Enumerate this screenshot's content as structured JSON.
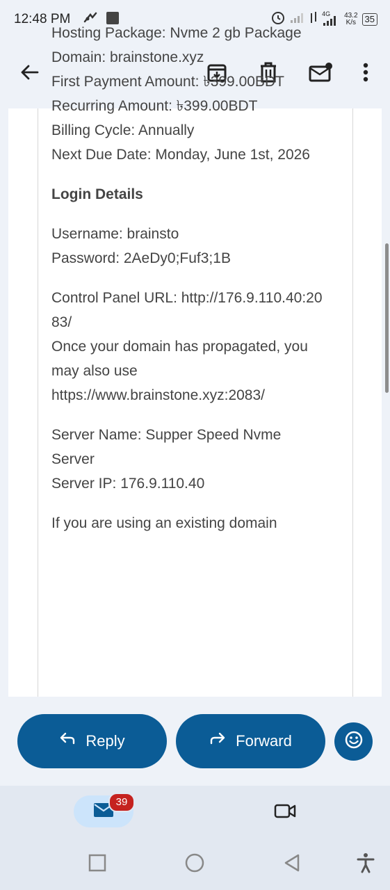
{
  "status_bar": {
    "time": "12:48 PM",
    "network_type": "4G",
    "speed_value": "43.2",
    "speed_unit": "K/s",
    "battery": "35"
  },
  "appbar": {
    "icons": [
      "back-arrow-icon",
      "archive-icon",
      "delete-icon",
      "mark-unread-icon",
      "more-vert-icon"
    ]
  },
  "email": {
    "paragraphs": [
      {
        "lines": [
          "Hosting Package: Nvme 2 gb Package",
          "Domain: brainstone.xyz",
          "First Payment Amount: ৳399.00BDT",
          "Recurring Amount: ৳399.00BDT",
          "Billing Cycle: Annually",
          "Next Due Date: Monday, June 1st, 2026"
        ]
      },
      {
        "heading": "Login Details"
      },
      {
        "lines": [
          "Username: brainsto",
          "Password: 2AeDy0;Fuf3;1B"
        ]
      },
      {
        "lines": [
          "Control Panel URL: http://176.9.110.40:2083/",
          "Once your domain has propagated, you may also use https://www.brainstone.xyz:2083/"
        ]
      },
      {
        "lines": [
          "Server Name: Supper Speed Nvme Server",
          "Server IP: 176.9.110.40"
        ]
      },
      {
        "lines": [
          "If you are using an existing domain"
        ]
      }
    ]
  },
  "actions": {
    "reply_label": "Reply",
    "forward_label": "Forward"
  },
  "bottom_nav": {
    "mail_badge": "39"
  },
  "colors": {
    "accent": "#0b5c96",
    "badge": "#c5221f",
    "nav_selected": "#cce4fb"
  }
}
